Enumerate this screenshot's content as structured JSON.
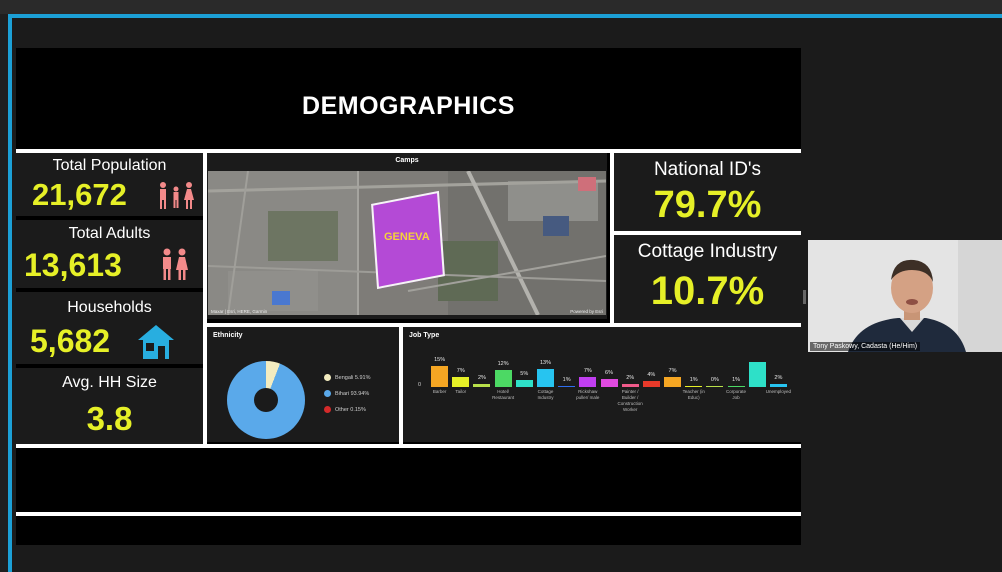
{
  "dashboard": {
    "title": "DEMOGRAPHICS"
  },
  "stats": {
    "total_population": {
      "label": "Total Population",
      "value": "21,672"
    },
    "total_adults": {
      "label": "Total Adults",
      "value": "13,613"
    },
    "households": {
      "label": "Households",
      "value": "5,682"
    },
    "avg_hh_size": {
      "label": "Avg. HH Size",
      "value": "3.8"
    },
    "national_ids": {
      "label": "National ID's",
      "value": "79.7%"
    },
    "cottage_industry": {
      "label": "Cottage Industry",
      "value": "10.7%"
    }
  },
  "map": {
    "title": "Camps",
    "polygon_label": "GENEVA",
    "attribution": "Maxar | Esri, HERE, Garmin",
    "powered_by": "Powered by Esri"
  },
  "ethnicity": {
    "title": "Ethnicity",
    "legend": [
      {
        "label": "Bengali 5.91%",
        "color": "#f3ecc0"
      },
      {
        "label": "Bihari 93.94%",
        "color": "#5aa9ea"
      },
      {
        "label": "Other 0.15%",
        "color": "#d42a2a"
      }
    ]
  },
  "job_type": {
    "title": "Job Type",
    "axis_zero": "0"
  },
  "chart_data": {
    "type": "bar",
    "title": "Job Type",
    "categories": [
      "Barber",
      "Tailor",
      "",
      "Hotel/ Restaurant",
      "",
      "Cottage Industry",
      "",
      "Rickshaw puller/ male",
      "",
      "Painter / Builder / Construction Worker",
      "",
      "",
      "Teacher (in Educ)",
      "",
      "Corporate Job",
      "",
      "Unemployed"
    ],
    "values": [
      15,
      7,
      2,
      12,
      5,
      13,
      1,
      7,
      6,
      2,
      4,
      7,
      1,
      0,
      1,
      18,
      2
    ],
    "labels": [
      "15%",
      "7%",
      "2%",
      "12%",
      "5%",
      "13%",
      "1%",
      "7%",
      "6%",
      "2%",
      "4%",
      "7%",
      "1%",
      "0%",
      "1%",
      "",
      "2%"
    ],
    "colors": [
      "#f5a623",
      "#e6f027",
      "#b8e04a",
      "#4cd964",
      "#2ee0c8",
      "#27c4f0",
      "#2f6ef0",
      "#c03ef0",
      "#e04ae0",
      "#f05a8a",
      "#e83a2a",
      "#f5a623",
      "#e6f027",
      "#b8e04a",
      "#4cd964",
      "#2ee0c8",
      "#27c4f0"
    ],
    "ylim": [
      0,
      20
    ]
  },
  "video": {
    "participant_name": "Tony Paskowy, Cadasta (He/Him)"
  }
}
